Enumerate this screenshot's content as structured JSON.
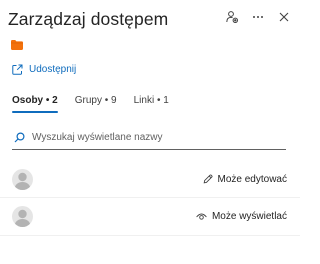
{
  "panel": {
    "title": "Zarządzaj dostępem"
  },
  "header_icons": [
    "manage-access-icon",
    "more-icon",
    "close-icon"
  ],
  "item": {
    "icon": "folder-icon",
    "color": "#f3710c"
  },
  "share": {
    "label": "Udostępnij",
    "icon": "share-icon"
  },
  "tabs": [
    {
      "label": "Osoby • 2",
      "active": true
    },
    {
      "label": "Grupy • 9",
      "active": false
    },
    {
      "label": "Linki • 1",
      "active": false
    }
  ],
  "search": {
    "placeholder": "Wyszukaj wyświetlane nazwy",
    "value": ""
  },
  "people": [
    {
      "permission": "Może edytować",
      "icon": "pencil-icon"
    },
    {
      "permission": "Może wyświetlać",
      "icon": "eye-icon"
    }
  ],
  "colors": {
    "accent": "#0f6cbd",
    "folder": "#f3710c"
  }
}
